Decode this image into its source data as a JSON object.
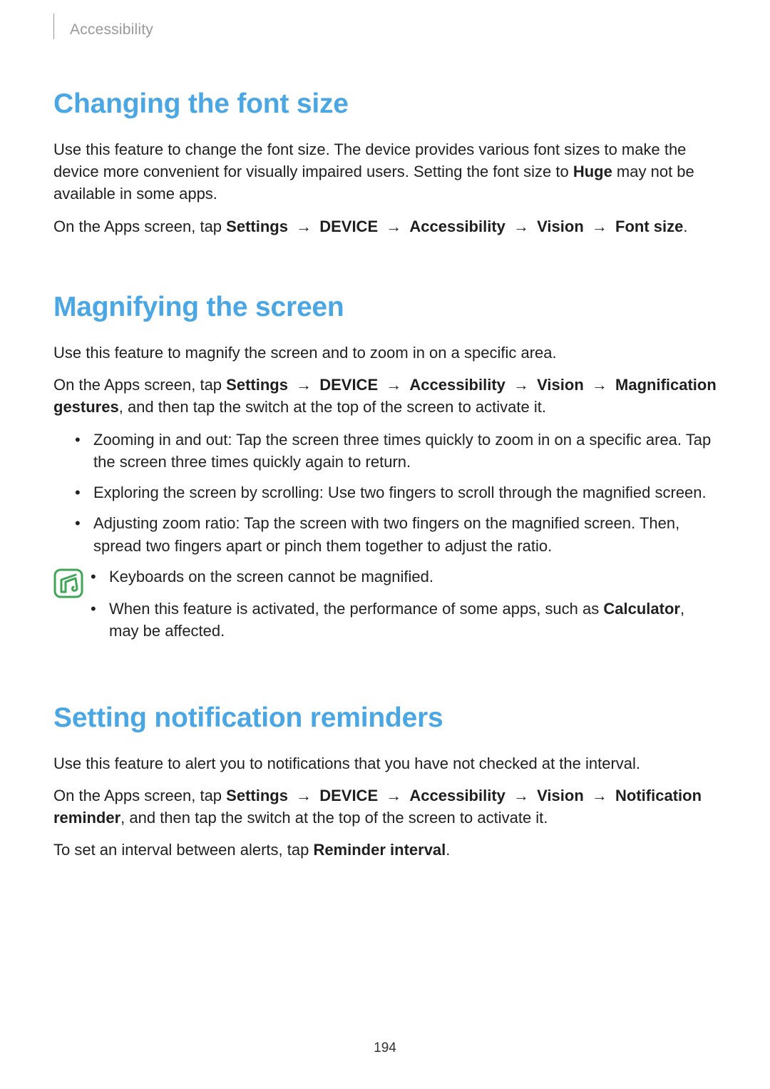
{
  "header": {
    "breadcrumb": "Accessibility"
  },
  "pageNumber": "194",
  "sec1": {
    "heading": "Changing the font size",
    "p1_before": "Use this feature to change the font size. The device provides various font sizes to make the device more convenient for visually impaired users. Setting the font size to ",
    "p1_bold": "Huge",
    "p1_after": " may not be available in some apps.",
    "p2_before": "On the Apps screen, tap ",
    "path": {
      "a": "Settings",
      "b": "DEVICE",
      "c": "Accessibility",
      "d": "Vision",
      "e": "Font size"
    },
    "p2_after": ".",
    "arrow": "→"
  },
  "sec2": {
    "heading": "Magnifying the screen",
    "p1": "Use this feature to magnify the screen and to zoom in on a specific area.",
    "p2_before": "On the Apps screen, tap ",
    "path": {
      "a": "Settings",
      "b": "DEVICE",
      "c": "Accessibility",
      "d": "Vision",
      "e": "Magnification gestures"
    },
    "p2_after": ", and then tap the switch at the top of the screen to activate it.",
    "bullets": {
      "b1": "Zooming in and out: Tap the screen three times quickly to zoom in on a specific area. Tap the screen three times quickly again to return.",
      "b2": "Exploring the screen by scrolling: Use two fingers to scroll through the magnified screen.",
      "b3": "Adjusting zoom ratio: Tap the screen with two fingers on the magnified screen. Then, spread two fingers apart or pinch them together to adjust the ratio."
    },
    "note": {
      "n1": "Keyboards on the screen cannot be magnified.",
      "n2_before": "When this feature is activated, the performance of some apps, such as ",
      "n2_bold": "Calculator",
      "n2_after": ", may be affected."
    }
  },
  "sec3": {
    "heading": "Setting notification reminders",
    "p1": "Use this feature to alert you to notifications that you have not checked at the interval.",
    "p2_before": "On the Apps screen, tap ",
    "path": {
      "a": "Settings",
      "b": "DEVICE",
      "c": "Accessibility",
      "d": "Vision",
      "e": "Notification reminder"
    },
    "p2_after": ", and then tap the switch at the top of the screen to activate it.",
    "p3_before": "To set an interval between alerts, tap ",
    "p3_bold": "Reminder interval",
    "p3_after": "."
  },
  "arrow": "→"
}
